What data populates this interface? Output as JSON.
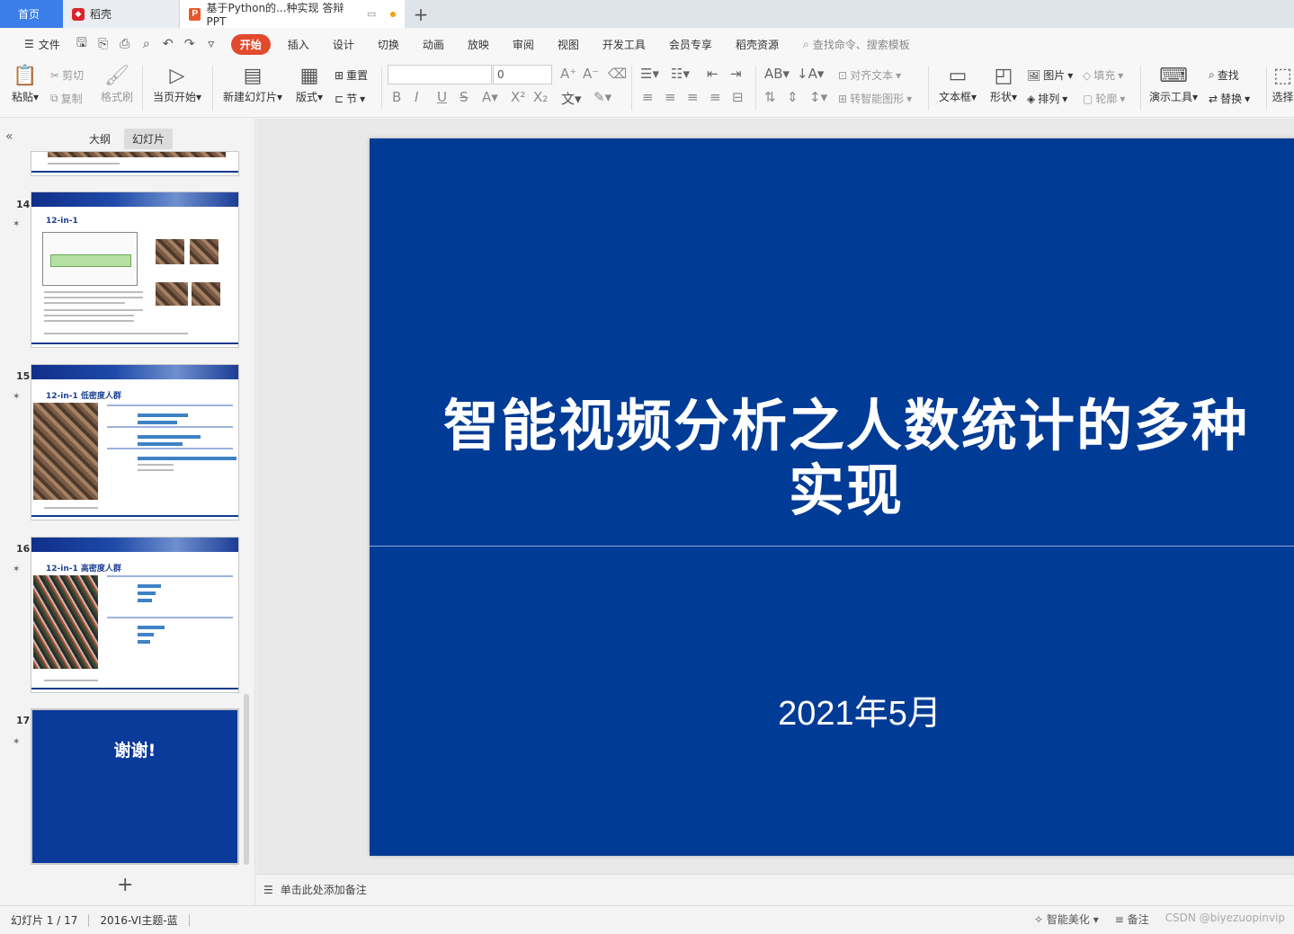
{
  "tabs": {
    "home": "首页",
    "daoke": "稻壳",
    "document": "基于Python的...种实现 答辩PPT"
  },
  "menu": {
    "file": "文件",
    "items": [
      "开始",
      "插入",
      "设计",
      "切换",
      "动画",
      "放映",
      "审阅",
      "视图",
      "开发工具",
      "会员专享",
      "稻壳资源"
    ],
    "search_placeholder": "查找命令、搜索模板"
  },
  "ribbon": {
    "paste": "粘贴",
    "cut": "剪切",
    "copy": "复制",
    "format_painter": "格式刷",
    "from_current": "当页开始",
    "new_slide": "新建幻灯片",
    "layout": "版式",
    "reset": "重置",
    "section": "节",
    "font_size": "0",
    "align_text": "对齐文本",
    "smart_shape": "转智能图形",
    "textbox": "文本框",
    "shape": "形状",
    "picture": "图片",
    "arrange": "排列",
    "fill": "填充",
    "outline": "轮廓",
    "present_tools": "演示工具",
    "find": "查找",
    "replace": "替换",
    "select": "选择"
  },
  "panel": {
    "outline_tab": "大纲",
    "slides_tab": "幻灯片",
    "thumbs": [
      {
        "num": "14",
        "title": "12-in-1"
      },
      {
        "num": "15",
        "title": "12-in-1 低密度人群"
      },
      {
        "num": "16",
        "title": "12-in-1 高密度人群"
      },
      {
        "num": "17",
        "title": "谢谢!"
      }
    ]
  },
  "slide": {
    "title": "智能视频分析之人数统计的多种实现",
    "date": "2021年5月",
    "bg_color": "#003b96"
  },
  "notes": {
    "placeholder": "单击此处添加备注"
  },
  "status": {
    "slide_index": "幻灯片 1 / 17",
    "theme": "2016-VI主题-蓝",
    "smart": "智能美化",
    "notes_btn": "备注",
    "watermark": "CSDN @biyezuopinvip"
  }
}
